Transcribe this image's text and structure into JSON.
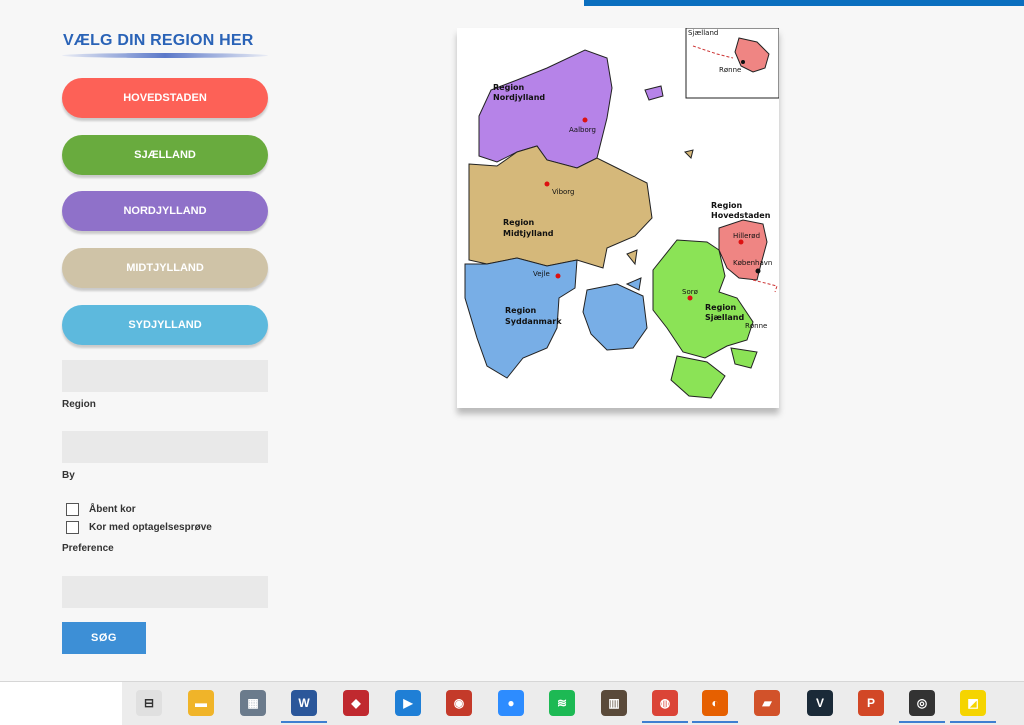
{
  "sidebar": {
    "title": "VÆLG DIN REGION HER",
    "buttons": [
      {
        "label": "HOVEDSTADEN",
        "color": "#fd6157"
      },
      {
        "label": "SJÆLLAND",
        "color": "#69ab3e"
      },
      {
        "label": "NORDJYLLAND",
        "color": "#8f71c9"
      },
      {
        "label": "MIDTJYLLAND",
        "color": "#cfc3a7"
      },
      {
        "label": "SYDJYLLAND",
        "color": "#5db9dd"
      }
    ],
    "region_label": "Region",
    "by_label": "By",
    "checkboxes": [
      "Åbent kor",
      "Kor med optagelsesprøve"
    ],
    "preference_label": "Preference",
    "search_button": "SØG"
  },
  "map": {
    "regions": {
      "nordjylland": {
        "name1": "Region",
        "name2": "Nordjylland",
        "color": "#b683e8"
      },
      "midtjylland": {
        "name1": "Region",
        "name2": "Midtjylland",
        "color": "#d5b87a"
      },
      "syddanmark": {
        "name1": "Region",
        "name2": "Syddanmark",
        "color": "#78aee6"
      },
      "sjaelland": {
        "name1": "Region",
        "name2": "Sjælland",
        "color": "#8be356"
      },
      "hovedstaden": {
        "name1": "Region",
        "name2": "Hovedstaden",
        "color": "#ef8583"
      }
    },
    "cities": [
      "Aalborg",
      "Viborg",
      "Vejle",
      "Sorø",
      "Hillerød",
      "København"
    ],
    "inset_label": "Sjælland",
    "inset_city": "Rønne",
    "bornholm_label": "Rønne"
  },
  "taskbar": {
    "icons": [
      {
        "name": "task-view-icon",
        "glyph": "⊟",
        "color": "#e0e0e0"
      },
      {
        "name": "file-explorer-icon",
        "glyph": "▬",
        "color": "#f0b429"
      },
      {
        "name": "calculator-icon",
        "glyph": "▦",
        "color": "#6b7b8c"
      },
      {
        "name": "word-icon",
        "glyph": "W",
        "color": "#2b579a"
      },
      {
        "name": "cube-app-icon",
        "glyph": "◆",
        "color": "#c0292f"
      },
      {
        "name": "media-player-icon",
        "glyph": "▶",
        "color": "#1f7fd6"
      },
      {
        "name": "record-app-icon",
        "glyph": "◉",
        "color": "#c43a2a"
      },
      {
        "name": "zoom-icon",
        "glyph": "●",
        "color": "#2d8cff"
      },
      {
        "name": "spotify-icon",
        "glyph": "≋",
        "color": "#1db954"
      },
      {
        "name": "piano-icon",
        "glyph": "▥",
        "color": "#5a4a3a"
      },
      {
        "name": "chrome-icon",
        "glyph": "◍",
        "color": "#db4437"
      },
      {
        "name": "firefox-icon",
        "glyph": "◐",
        "color": "#e66000"
      },
      {
        "name": "red-app-icon",
        "glyph": "▰",
        "color": "#d2522a"
      },
      {
        "name": "v-app-icon",
        "glyph": "V",
        "color": "#1a2a38"
      },
      {
        "name": "powerpoint-icon",
        "glyph": "P",
        "color": "#d24726"
      },
      {
        "name": "disc-app-icon",
        "glyph": "◎",
        "color": "#333333"
      },
      {
        "name": "sticky-notes-icon",
        "glyph": "◩",
        "color": "#f5d400"
      }
    ]
  }
}
